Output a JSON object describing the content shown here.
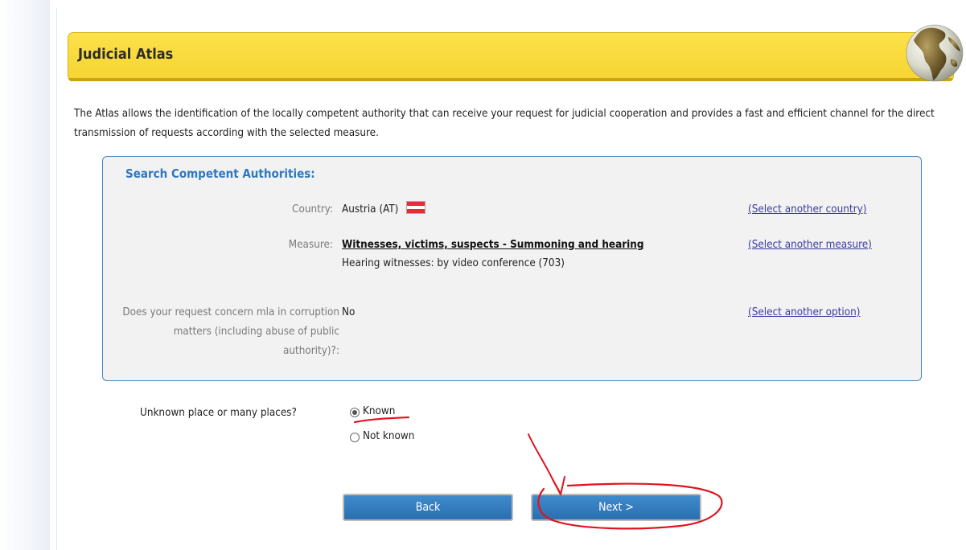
{
  "header": {
    "title": "Judicial Atlas"
  },
  "intro_text": "The Atlas allows the identification of the locally competent authority that can receive your request for judicial cooperation and provides a fast and efficient channel for the direct transmission of requests according with the selected measure.",
  "search_panel": {
    "title": "Search Competent Authorities:",
    "country": {
      "label": "Country:",
      "value": "Austria (AT)",
      "flag_colors": [
        "#ed2939",
        "#ffffff",
        "#ed2939"
      ],
      "link": "(Select another country)"
    },
    "measure": {
      "label": "Measure:",
      "name": "Witnesses, victims, suspects - Summoning and hearing",
      "detail": "Hearing witnesses: by video conference (703)",
      "link": "(Select another measure)"
    },
    "option": {
      "label": "Does your request concern mla in corruption matters (including abuse of public authority)?:",
      "value": "No",
      "link": "(Select another option)"
    }
  },
  "place": {
    "label": "Unknown place or many places?",
    "options": [
      {
        "label": "Known",
        "selected": true
      },
      {
        "label": "Not known",
        "selected": false
      }
    ]
  },
  "buttons": {
    "back": "Back",
    "next": "Next >"
  },
  "colors": {
    "header_yellow": "#f6d432",
    "panel_border": "#3d85c6",
    "button_blue": "#2a6fb0",
    "annotation_red": "#e0141e"
  }
}
